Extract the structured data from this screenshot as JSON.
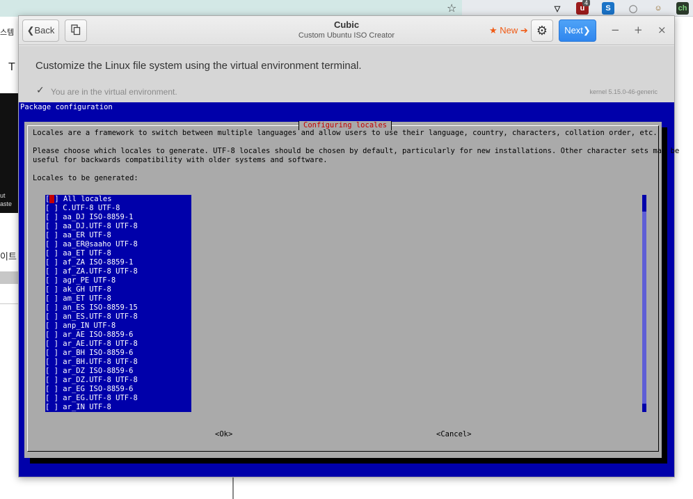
{
  "browser": {
    "tab_text_left": "스템",
    "side_letter": "T",
    "side_text_1": "ut",
    "side_text_2": "aste",
    "side_text_3": "이트",
    "ext_badge_count": "4"
  },
  "window": {
    "title": "Cubic",
    "subtitle": "Custom Ubuntu ISO Creator",
    "back_label": "❮Back",
    "new_label": "★ New ➔",
    "next_label": "Next❯",
    "minimize": "−",
    "maximize": "+",
    "close": "×"
  },
  "page": {
    "instruction": "Customize the Linux file system using the virtual environment terminal.",
    "status": "You are in the virtual environment.",
    "kernel": "kernel 5.15.0-46-generic"
  },
  "terminal": {
    "backtitle": "Package configuration",
    "dialog_title": "Configuring locales",
    "line1": "Locales are a framework to switch between multiple languages and allow users to use their language, country, characters, collation order, etc.",
    "line2": "Please choose which locales to generate. UTF-8 locales should be chosen by default, particularly for new installations. Other character sets may be",
    "line3": "useful for backwards compatibility with older systems and software.",
    "line4": "Locales to be generated:",
    "ok": "<Ok>",
    "cancel": "<Cancel>",
    "locales": [
      "All locales",
      "C.UTF-8 UTF-8",
      "aa_DJ ISO-8859-1",
      "aa_DJ.UTF-8 UTF-8",
      "aa_ER UTF-8",
      "aa_ER@saaho UTF-8",
      "aa_ET UTF-8",
      "af_ZA ISO-8859-1",
      "af_ZA.UTF-8 UTF-8",
      "agr_PE UTF-8",
      "ak_GH UTF-8",
      "am_ET UTF-8",
      "an_ES ISO-8859-15",
      "an_ES.UTF-8 UTF-8",
      "anp_IN UTF-8",
      "ar_AE ISO-8859-6",
      "ar_AE.UTF-8 UTF-8",
      "ar_BH ISO-8859-6",
      "ar_BH.UTF-8 UTF-8",
      "ar_DZ ISO-8859-6",
      "ar_DZ.UTF-8 UTF-8",
      "ar_EG ISO-8859-6",
      "ar_EG.UTF-8 UTF-8",
      "ar_IN UTF-8"
    ]
  },
  "colors": {
    "terminal_blue": "#0000aa",
    "dialog_gray": "#aaaaaa",
    "title_red": "#c40000",
    "next_blue": "#2f86ee",
    "new_orange": "#f05a14"
  }
}
